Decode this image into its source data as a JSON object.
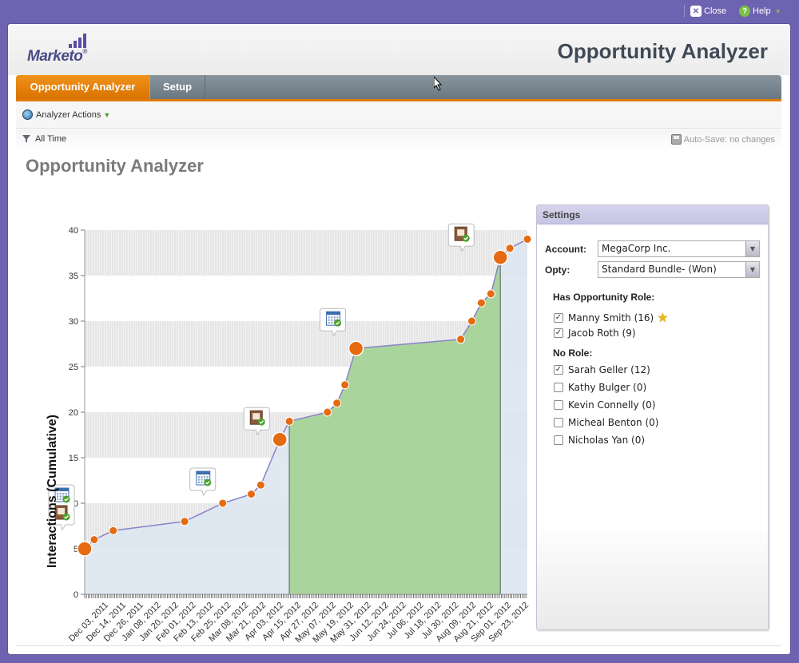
{
  "topbar": {
    "close_label": "Close",
    "help_label": "Help"
  },
  "header": {
    "logo_text": "Marketo",
    "app_title": "Opportunity Analyzer"
  },
  "tabs": [
    {
      "label": "Opportunity Analyzer",
      "active": true
    },
    {
      "label": "Setup",
      "active": false
    }
  ],
  "actions": {
    "label": "Analyzer Actions"
  },
  "filter": {
    "time_label": "All Time",
    "autosave_label": "Auto-Save: no changes"
  },
  "page_heading": "Opportunity Analyzer",
  "settings": {
    "title": "Settings",
    "account_label": "Account:",
    "account_value": "MegaCorp Inc.",
    "opty_label": "Opty:",
    "opty_value": "Standard Bundle- (Won)",
    "has_role_title": "Has Opportunity Role:",
    "has_role": [
      {
        "label": "Manny Smith (16)",
        "checked": true,
        "starred": true
      },
      {
        "label": "Jacob Roth (9)",
        "checked": true,
        "starred": false
      }
    ],
    "no_role_title": "No Role:",
    "no_role": [
      {
        "label": "Sarah Geller (12)",
        "checked": true
      },
      {
        "label": "Kathy Bulger (0)",
        "checked": false
      },
      {
        "label": "Kevin Connelly (0)",
        "checked": false
      },
      {
        "label": "Micheal Benton (0)",
        "checked": false
      },
      {
        "label": "Nicholas Yan (0)",
        "checked": false
      }
    ]
  },
  "chart_data": {
    "type": "line",
    "ylabel": "Interactions (Cumulative)",
    "xlabel": "",
    "ylim": [
      0,
      40
    ],
    "yticks": [
      0,
      5,
      10,
      15,
      20,
      25,
      30,
      35,
      40
    ],
    "x_tick_labels": [
      "Dec 03, 2011",
      "Dec 14, 2011",
      "Dec 26, 2011",
      "Jan 08, 2012",
      "Jan 20, 2012",
      "Feb 01, 2012",
      "Feb 13, 2012",
      "Feb 25, 2012",
      "Mar 08, 2012",
      "Mar 21, 2012",
      "Apr 03, 2012",
      "Apr 15, 2012",
      "Apr 27, 2012",
      "May 07, 2012",
      "May 19, 2012",
      "May 31, 2012",
      "Jun 12, 2012",
      "Jun 24, 2012",
      "Jul 06, 2012",
      "Jul 18, 2012",
      "Jul 30, 2012",
      "Aug 09, 2012",
      "Aug 21, 2012",
      "Sep 01, 2012",
      "Sep 23, 2012"
    ],
    "points": [
      {
        "x": "2011-12-01",
        "y": 5,
        "major": true
      },
      {
        "x": "2011-12-07",
        "y": 6
      },
      {
        "x": "2011-12-19",
        "y": 7
      },
      {
        "x": "2012-02-02",
        "y": 8
      },
      {
        "x": "2012-02-26",
        "y": 10
      },
      {
        "x": "2012-03-15",
        "y": 11
      },
      {
        "x": "2012-03-21",
        "y": 12
      },
      {
        "x": "2012-04-02",
        "y": 17,
        "major": true
      },
      {
        "x": "2012-04-08",
        "y": 19
      },
      {
        "x": "2012-05-02",
        "y": 20
      },
      {
        "x": "2012-05-08",
        "y": 21
      },
      {
        "x": "2012-05-13",
        "y": 23
      },
      {
        "x": "2012-05-20",
        "y": 27,
        "major": true
      },
      {
        "x": "2012-07-25",
        "y": 28
      },
      {
        "x": "2012-08-01",
        "y": 30
      },
      {
        "x": "2012-08-07",
        "y": 32
      },
      {
        "x": "2012-08-13",
        "y": 33
      },
      {
        "x": "2012-08-19",
        "y": 37,
        "major": true
      },
      {
        "x": "2012-08-25",
        "y": 38
      },
      {
        "x": "2012-09-05",
        "y": 39
      }
    ],
    "opportunity_window": {
      "start": "2012-04-08",
      "end": "2012-08-19"
    },
    "callouts": [
      {
        "x": "2011-12-01",
        "y": 5,
        "icons": [
          "calendar-check",
          "document-check"
        ]
      },
      {
        "x": "2012-02-26",
        "y": 10,
        "icons": [
          "calendar-check"
        ]
      },
      {
        "x": "2012-04-02",
        "y": 17,
        "icons": [
          "document-check"
        ]
      },
      {
        "x": "2012-05-20",
        "y": 27,
        "icons": [
          "calendar-check"
        ]
      },
      {
        "x": "2012-08-19",
        "y": 37,
        "icons": [
          "document-check"
        ]
      }
    ],
    "colors": {
      "line": "#8a83c9",
      "point": "#e56a10",
      "area_outside": "#dde5f1",
      "area_opportunity": "#a9d49b"
    }
  }
}
